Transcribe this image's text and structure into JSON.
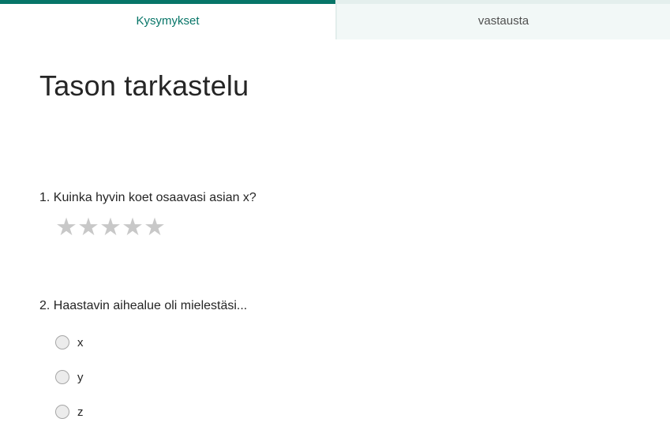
{
  "tabs": [
    {
      "label": "Kysymykset",
      "active": true
    },
    {
      "label": "vastausta",
      "active": false
    }
  ],
  "form": {
    "title": "Tason tarkastelu"
  },
  "questions": [
    {
      "number_text": "1. Kuinka hyvin koet osaavasi asian x?",
      "type": "rating",
      "max_stars": 5,
      "selected_stars": 0,
      "star_glyph": "★"
    },
    {
      "number_text": "2. Haastavin aihealue oli mielestäsi...",
      "type": "choice",
      "options": [
        "x",
        "y",
        "z"
      ]
    }
  ],
  "colors": {
    "accent": "#077568",
    "inactive_tab_bg": "#f2f8f7",
    "star_empty": "#c8c8c8"
  }
}
